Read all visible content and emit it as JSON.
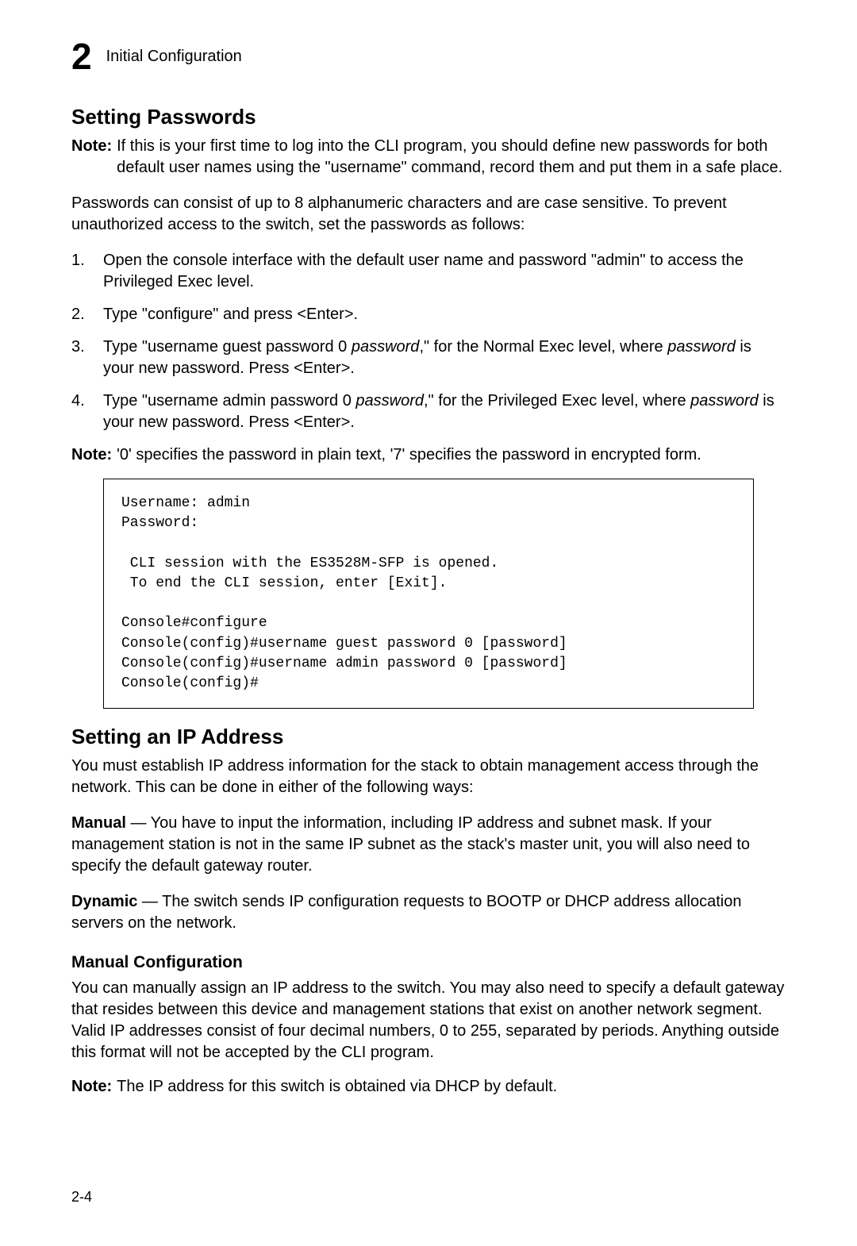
{
  "header": {
    "chapter_number": "2",
    "chapter_title": "Initial Configuration"
  },
  "sections": {
    "passwords": {
      "heading": "Setting Passwords",
      "note1_label": "Note:",
      "note1_body": "If this is your first time to log into the CLI program, you should define new passwords for both default user names using the \"username\" command, record them and put them in a safe place.",
      "para1": "Passwords can consist of up to 8 alphanumeric characters and are case sensitive. To prevent unauthorized access to the switch, set the passwords as follows:",
      "list": [
        {
          "num": "1.",
          "text": "Open the console interface with the default user name and password \"admin\" to access the Privileged Exec level."
        },
        {
          "num": "2.",
          "text": "Type \"configure\" and press <Enter>."
        },
        {
          "num": "3.",
          "prefix": "Type \"username guest password 0 ",
          "em1": "password",
          "mid": ",\" for the Normal Exec level, where ",
          "em2": "password",
          "suffix": " is your new password. Press <Enter>."
        },
        {
          "num": "4.",
          "prefix": "Type \"username admin password 0 ",
          "em1": "password",
          "mid": ",\" for the Privileged Exec level, where ",
          "em2": "password",
          "suffix": " is your new password. Press <Enter>."
        }
      ],
      "note2_label": "Note:",
      "note2_body": "'0' specifies the password in plain text, '7' specifies the password in encrypted form.",
      "code": "Username: admin\nPassword:\n\n CLI session with the ES3528M-SFP is opened.\n To end the CLI session, enter [Exit].\n\nConsole#configure\nConsole(config)#username guest password 0 [password]\nConsole(config)#username admin password 0 [password]\nConsole(config)#"
    },
    "ip": {
      "heading": "Setting an IP Address",
      "para1": "You must establish IP address information for the stack to obtain management access through the network. This can be done in either of the following ways:",
      "manual_label": "Manual",
      "manual_text": " — You have to input the information, including IP address and subnet mask. If your management station is not in the same IP subnet as the stack's master unit, you will also need to specify the default gateway router.",
      "dynamic_label": "Dynamic",
      "dynamic_text": " — The switch sends IP configuration requests to BOOTP or DHCP address allocation servers on the network.",
      "sub_heading": "Manual Configuration",
      "para2": "You can manually assign an IP address to the switch. You may also need to specify a default gateway that resides between this device and management stations that exist on another network segment. Valid IP addresses consist of four decimal numbers, 0 to 255, separated by periods. Anything outside this format will not be accepted by the CLI program.",
      "note_label": "Note:",
      "note_body": "The IP address for this switch is obtained via DHCP by default."
    }
  },
  "page_number": "2-4"
}
